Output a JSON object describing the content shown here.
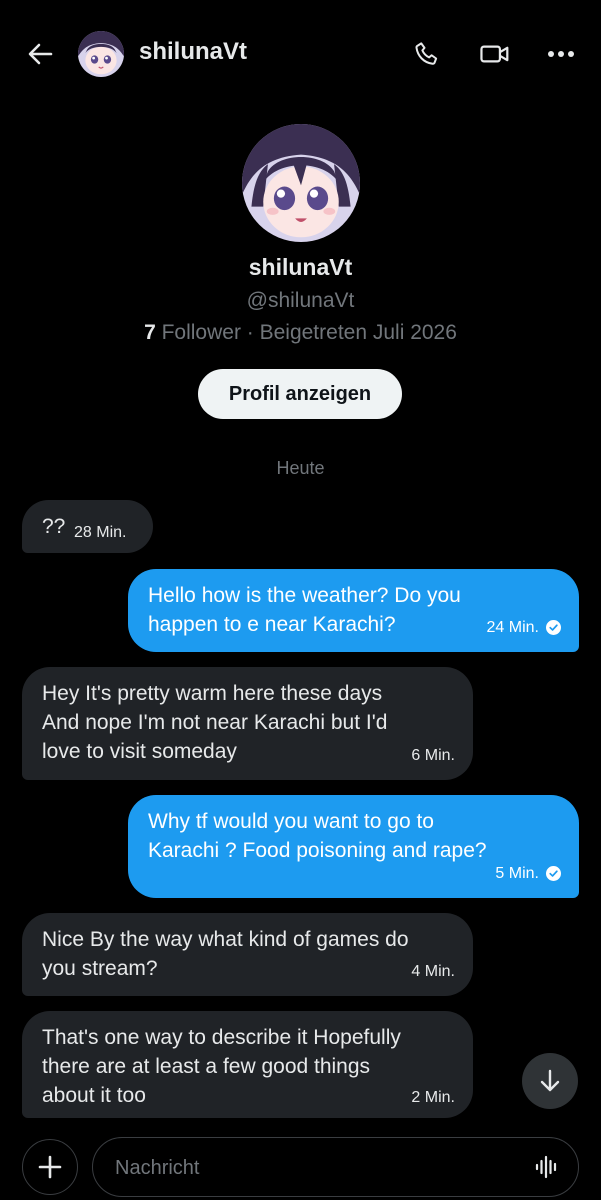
{
  "header": {
    "title": "shilunaVt"
  },
  "profile": {
    "name": "shilunaVt",
    "handle": "@shilunaVt",
    "followers_count": "7",
    "followers_text": " Follower · Beigetreten Juli 2026",
    "button_label": "Profil anzeigen"
  },
  "date_separator": "Heute",
  "messages": [
    {
      "direction": "in",
      "lines": [
        "??"
      ],
      "time": "28 Min."
    },
    {
      "direction": "out",
      "lines": [
        "Hello how is the weather? Do you",
        "happen to  e near Karachi?"
      ],
      "time": "24 Min.",
      "read": true
    },
    {
      "direction": "in",
      "lines": [
        "Hey It's pretty warm here these days",
        "And nope I'm not near Karachi but I'd",
        "love to visit someday"
      ],
      "time": "6 Min."
    },
    {
      "direction": "out",
      "lines": [
        "Why tf would you want to go to",
        "Karachi ? Food poisoning and rape?"
      ],
      "time": "5 Min.",
      "read": true
    },
    {
      "direction": "in",
      "lines": [
        "Nice By the way  what kind of games do",
        "you stream?"
      ],
      "time": "4 Min."
    },
    {
      "direction": "in",
      "lines": [
        "That's one way to describe it  Hopefully",
        "there are at least a few good things",
        "about it too"
      ],
      "time": "2 Min."
    }
  ],
  "composer": {
    "placeholder": "Nachricht"
  },
  "colors": {
    "background": "#000000",
    "accent": "#1d9bf0",
    "incoming_bubble": "#202327",
    "muted_text": "#71767b"
  },
  "icons": [
    "back-arrow-icon",
    "phone-icon",
    "video-camera-icon",
    "more-icon",
    "arrow-down-icon",
    "plus-icon",
    "voice-wave-icon",
    "read-check-icon"
  ]
}
